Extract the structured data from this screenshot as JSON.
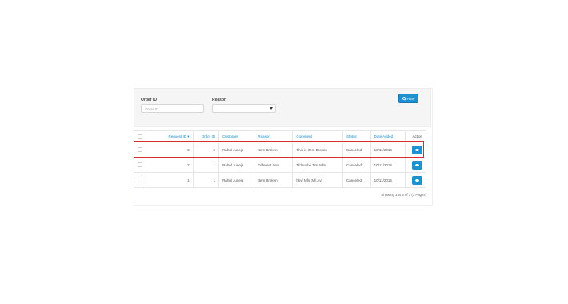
{
  "filter": {
    "order_id_label": "Order ID",
    "order_id_placeholder": "Order ID",
    "reason_label": "Reason",
    "reason_selected": "",
    "button_label": "Filter",
    "button_icon": "search-icon"
  },
  "table": {
    "headers": [
      "Request ID ▾",
      "Order ID",
      "Customer",
      "Reason",
      "Comment",
      "Status",
      "Date Added",
      "Action"
    ],
    "rows": [
      {
        "request_id": "3",
        "order_id": "2",
        "customer": "Rahul Juneja",
        "reason": "Item Broken",
        "comment": "This is Item Broken",
        "status": "Canceled",
        "date_added": "10/11/2015"
      },
      {
        "request_id": "2",
        "order_id": "1",
        "customer": "Rahul Juneja",
        "reason": "Different Item",
        "comment": "Tfdanyhe Tsrr Mfsi",
        "status": "Canceled",
        "date_added": "10/11/2015"
      },
      {
        "request_id": "1",
        "order_id": "1",
        "customer": "Rahul Juneja",
        "reason": "Item Broken",
        "comment": "hkyf Mfsi Mfj Ayf",
        "status": "Canceled",
        "date_added": "10/11/2015"
      }
    ]
  },
  "pagination": {
    "text": "Showing 1 to 3 of 3 (1 Pages)"
  },
  "colors": {
    "accent": "#1e91cf",
    "highlight": "#d62f2f"
  }
}
